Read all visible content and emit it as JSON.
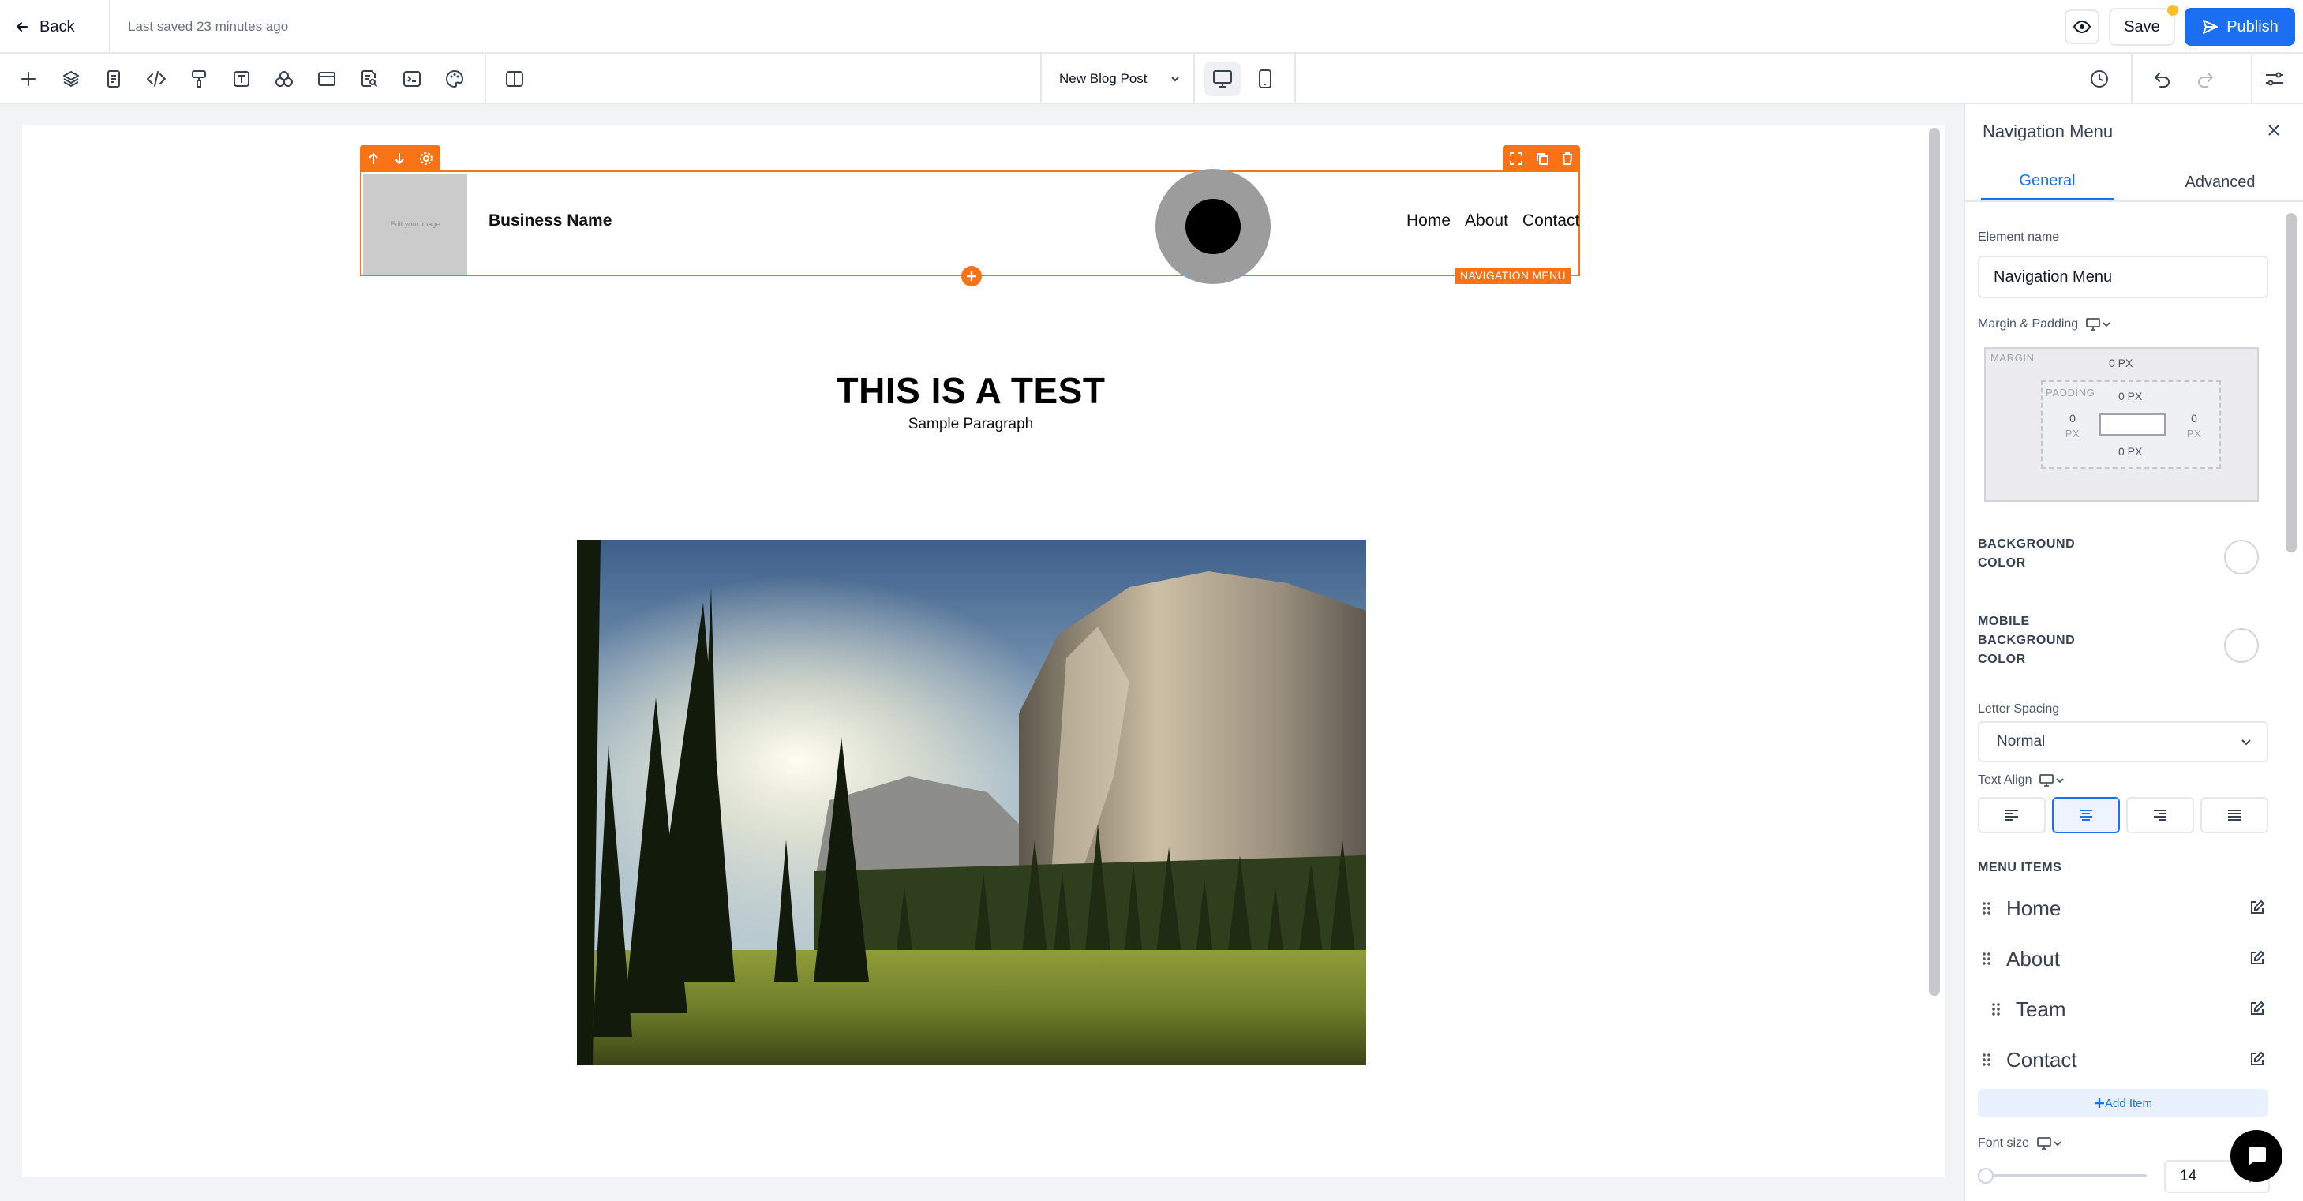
{
  "topbar": {
    "back_label": "Back",
    "last_saved": "Last saved 23 minutes ago",
    "save_label": "Save",
    "publish_label": "Publish"
  },
  "toolbar": {
    "tools": [
      "plus-icon",
      "layers-icon",
      "page-icon",
      "code-icon",
      "paint-roller-icon",
      "text-icon",
      "shapes-icon",
      "window-icon",
      "search-doc-icon",
      "terminal-icon",
      "palette-icon",
      "columns-icon"
    ],
    "page_name": "New Blog Post",
    "device": "desktop"
  },
  "canvas": {
    "nav": {
      "logo_placeholder": "Edit your image",
      "business_name": "Business Name",
      "links": [
        "Home",
        "About",
        "Contact"
      ],
      "section_label": "NAVIGATION MENU"
    },
    "heading": "THIS IS A TEST",
    "paragraph": "Sample Paragraph"
  },
  "panel": {
    "title": "Navigation Menu",
    "tabs": [
      "General",
      "Advanced"
    ],
    "active_tab": "General",
    "element_name_label": "Element name",
    "element_name_value": "Navigation Menu",
    "margin_padding_label": "Margin & Padding",
    "box": {
      "margin_label": "MARGIN",
      "padding_label": "PADDING",
      "margin_top": "0 PX",
      "padding_top": "0 PX",
      "padding_left": "0",
      "padding_left_unit": "PX",
      "padding_right": "0",
      "padding_right_unit": "PX",
      "padding_bottom": "0 PX"
    },
    "background_color_label_1": "BACKGROUND",
    "background_color_label_2": "COLOR",
    "mobile_bg_label_1": "MOBILE",
    "mobile_bg_label_2": "BACKGROUND",
    "mobile_bg_label_3": "COLOR",
    "letter_spacing_label": "Letter Spacing",
    "letter_spacing_value": "Normal",
    "text_align_label": "Text Align",
    "text_align_active": "center",
    "menu_items_label": "MENU ITEMS",
    "menu_items": [
      {
        "label": "Home",
        "indent": 0
      },
      {
        "label": "About",
        "indent": 0
      },
      {
        "label": "Team",
        "indent": 1
      },
      {
        "label": "Contact",
        "indent": 0
      }
    ],
    "add_item_label": "Add Item",
    "font_size_label": "Font size",
    "font_size_value": "14",
    "font_size_unit": "px"
  },
  "colors": {
    "accent_orange": "#f97316",
    "primary_blue": "#1d6ff2"
  }
}
